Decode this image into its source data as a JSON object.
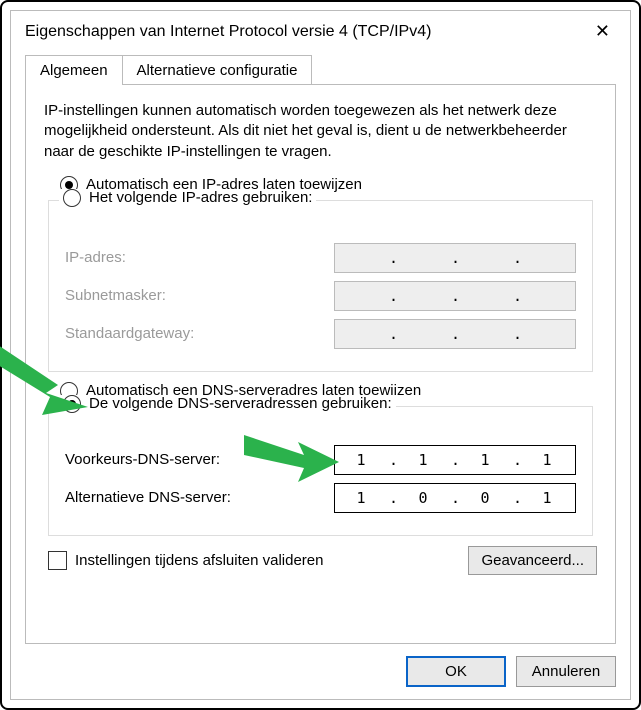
{
  "window": {
    "title": "Eigenschappen van Internet Protocol versie 4 (TCP/IPv4)"
  },
  "tabs": {
    "general": "Algemeen",
    "alternate": "Alternatieve configuratie"
  },
  "intro": "IP-instellingen kunnen automatisch worden toegewezen als het netwerk deze mogelijkheid ondersteunt. Als dit niet het geval is, dient u de netwerkbeheerder naar de geschikte IP-instellingen te vragen.",
  "ip": {
    "auto_label": "Automatisch een IP-adres laten toewijzen",
    "manual_label": "Het volgende IP-adres gebruiken:",
    "address_label": "IP-adres:",
    "subnet_label": "Subnetmasker:",
    "gateway_label": "Standaardgateway:",
    "auto_selected": true,
    "address": "",
    "subnet": "",
    "gateway": ""
  },
  "dns": {
    "auto_label": "Automatisch een DNS-serveradres laten toewijzen",
    "manual_label": "De volgende DNS-serveradressen gebruiken:",
    "preferred_label": "Voorkeurs-DNS-server:",
    "alternate_label": "Alternatieve DNS-server:",
    "manual_selected": true,
    "preferred": {
      "a": "1",
      "b": "1",
      "c": "1",
      "d": "1"
    },
    "alternate": {
      "a": "1",
      "b": "0",
      "c": "0",
      "d": "1"
    }
  },
  "validate_label": "Instellingen tijdens afsluiten valideren",
  "validate_checked": false,
  "buttons": {
    "advanced": "Geavanceerd...",
    "ok": "OK",
    "cancel": "Annuleren"
  }
}
